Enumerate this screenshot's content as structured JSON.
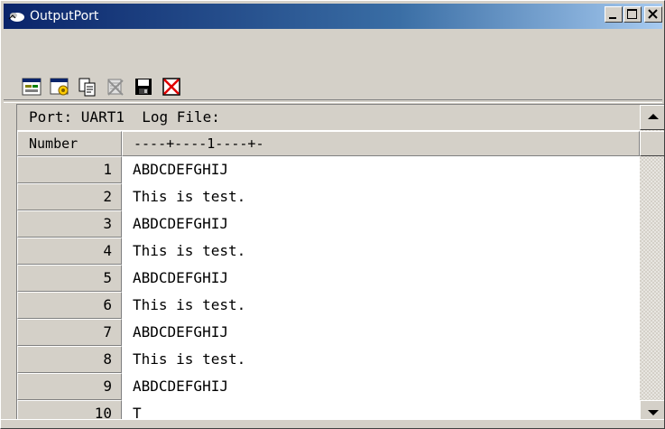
{
  "window": {
    "title": "OutputPort"
  },
  "colors": {
    "title_bar_start": "#0a246a",
    "title_bar_end": "#a6caf0",
    "chrome": "#d4d0c8"
  },
  "title_buttons": [
    "minimize-icon",
    "maximize-icon",
    "close-icon"
  ],
  "toolbar": {
    "tools": [
      {
        "name": "connect-icon"
      },
      {
        "name": "settings-icon"
      },
      {
        "name": "copy-icon"
      },
      {
        "name": "clear-icon"
      },
      {
        "name": "save-icon"
      },
      {
        "name": "stop-icon"
      }
    ]
  },
  "port_bar": {
    "text": "Port: UART1  Log File:"
  },
  "table": {
    "header_number": "Number",
    "header_ruler": "----+----1----+-",
    "rows": [
      {
        "num": "1",
        "text": "ABDCDEFGHIJ"
      },
      {
        "num": "2",
        "text": "This is test."
      },
      {
        "num": "3",
        "text": "ABDCDEFGHIJ"
      },
      {
        "num": "4",
        "text": "This is test."
      },
      {
        "num": "5",
        "text": "ABDCDEFGHIJ"
      },
      {
        "num": "6",
        "text": "This is test."
      },
      {
        "num": "7",
        "text": "ABDCDEFGHIJ"
      },
      {
        "num": "8",
        "text": "This is test."
      },
      {
        "num": "9",
        "text": "ABDCDEFGHIJ"
      },
      {
        "num": "10",
        "text": "T"
      }
    ]
  }
}
